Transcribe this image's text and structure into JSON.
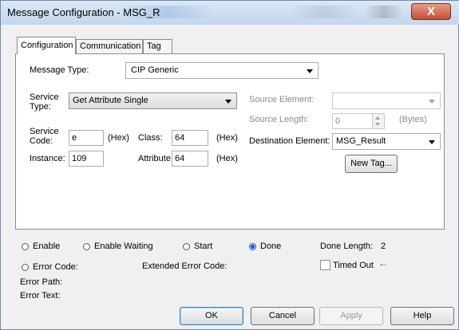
{
  "window": {
    "title": "Message Configuration - MSG_R",
    "close_glyph": "X"
  },
  "tabs": [
    {
      "label": "Configuration",
      "active": true
    },
    {
      "label": "Communication",
      "active": false
    },
    {
      "label": "Tag",
      "active": false
    }
  ],
  "config": {
    "message_type_label": "Message Type:",
    "message_type_value": "CIP Generic",
    "service_type_label": "Service Type:",
    "service_type_value": "Get Attribute Single",
    "service_code_label": "Service Code:",
    "service_code_value": "e",
    "service_code_unit": "(Hex)",
    "class_label": "Class:",
    "class_value": "64",
    "class_unit": "(Hex)",
    "instance_label": "Instance:",
    "instance_value": "109",
    "attribute_label": "Attribute:",
    "attribute_value": "64",
    "attribute_unit": "(Hex)",
    "source_element_label": "Source Element:",
    "source_element_value": "",
    "source_length_label": "Source Length:",
    "source_length_value": "0",
    "source_length_unit": "(Bytes)",
    "destination_element_label": "Destination Element:",
    "destination_element_value": "MSG_Result",
    "new_tag_label": "New Tag..."
  },
  "status": {
    "enable": "Enable",
    "enable_waiting": "Enable Waiting",
    "start": "Start",
    "done": "Done",
    "done_length_label": "Done Length:",
    "done_length_value": "2",
    "error_code": "Error Code:",
    "extended_error_code": "Extended Error Code:",
    "timed_out": "Timed Out",
    "timed_out_arrow": "←",
    "error_path": "Error Path:",
    "error_text": "Error Text:"
  },
  "buttons": {
    "ok": "OK",
    "cancel": "Cancel",
    "apply": "Apply",
    "help": "Help"
  },
  "colors": {
    "radio_selected": "#1f5fd8",
    "close_button": "#c54f33"
  }
}
